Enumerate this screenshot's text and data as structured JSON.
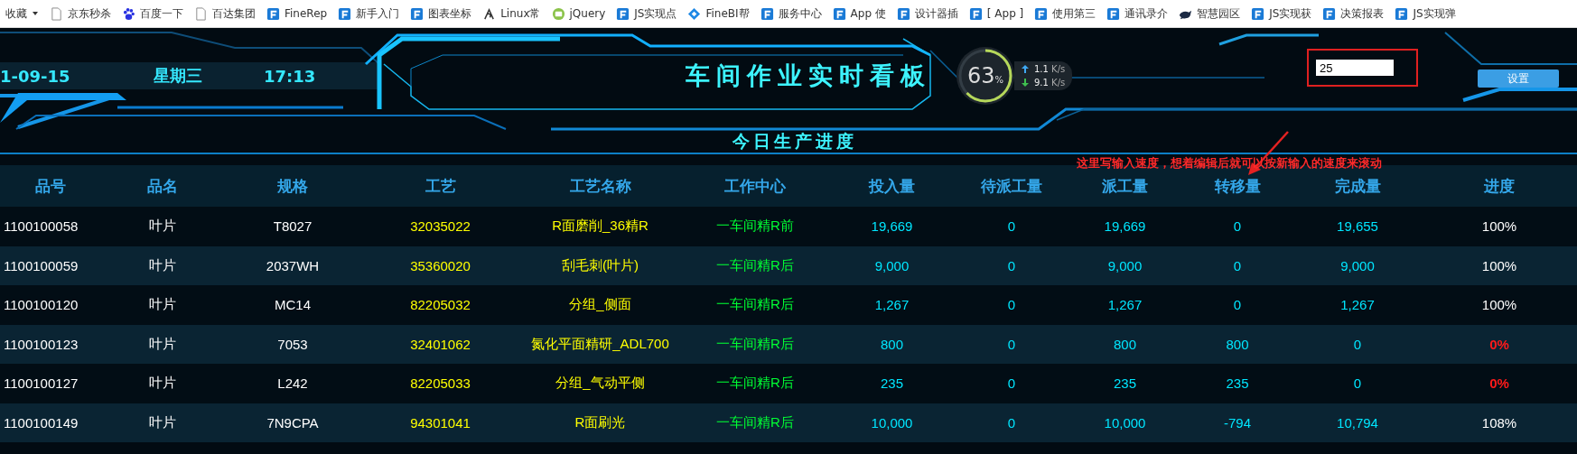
{
  "bookmarks": [
    {
      "kind": "menu",
      "label": "收藏"
    },
    {
      "kind": "page",
      "label": "京东秒杀"
    },
    {
      "kind": "paw",
      "label": "百度一下"
    },
    {
      "kind": "page",
      "label": "百达集团"
    },
    {
      "kind": "fr",
      "label": "FineRep"
    },
    {
      "kind": "fr",
      "label": "新手入门"
    },
    {
      "kind": "fr",
      "label": "图表坐标"
    },
    {
      "kind": "linux",
      "label": "Linux常"
    },
    {
      "kind": "jquery",
      "label": "jQuery"
    },
    {
      "kind": "fr",
      "label": "JS实现点"
    },
    {
      "kind": "finebi",
      "label": "FineBI帮"
    },
    {
      "kind": "fr",
      "label": "服务中心"
    },
    {
      "kind": "fr",
      "label": "App 使"
    },
    {
      "kind": "fr",
      "label": "设计器插"
    },
    {
      "kind": "fr",
      "label": "[ App ]"
    },
    {
      "kind": "fr",
      "label": "使用第三"
    },
    {
      "kind": "fr",
      "label": "通讯录介"
    },
    {
      "kind": "bird",
      "label": "智慧园区"
    },
    {
      "kind": "fr",
      "label": "JS实现获"
    },
    {
      "kind": "fr",
      "label": "决策报表"
    },
    {
      "kind": "fr",
      "label": "JS实现弹"
    }
  ],
  "header": {
    "date": "1-09-15",
    "weekday": "星期三",
    "time": "17:13",
    "title": "车间作业实时看板",
    "gauge": {
      "value": "63",
      "unit": "%",
      "level": 0.63,
      "up": "1.1",
      "up_unit": "K/s",
      "down": "9.1",
      "down_unit": "K/s"
    },
    "speed_input": {
      "value": "25"
    },
    "set_button": "设置"
  },
  "section_title": "今日生产进度",
  "annotation": "这里写输入速度，想着编辑后就可以按新输入的速度来滚动",
  "table": {
    "columns": [
      "品号",
      "品名",
      "规格",
      "工艺",
      "工艺名称",
      "工作中心",
      "投入量",
      "待派工量",
      "派工量",
      "转移量",
      "完成量",
      "进度"
    ],
    "rows": [
      {
        "cells": [
          "1100100058",
          "叶片",
          "T8027",
          "32035022",
          "R面磨削_36精R",
          "一车间精R前",
          "19,669",
          "0",
          "19,669",
          "0",
          "19,655",
          "100%"
        ],
        "alert": false
      },
      {
        "cells": [
          "1100100059",
          "叶片",
          "2037WH",
          "35360020",
          "刮毛刺(叶片)",
          "一车间精R后",
          "9,000",
          "0",
          "9,000",
          "0",
          "9,000",
          "100%"
        ],
        "alert": false
      },
      {
        "cells": [
          "1100100120",
          "叶片",
          "MC14",
          "82205032",
          "分组_侧面",
          "一车间精R后",
          "1,267",
          "0",
          "1,267",
          "0",
          "1,267",
          "100%"
        ],
        "alert": false
      },
      {
        "cells": [
          "1100100123",
          "叶片",
          "7053",
          "32401062",
          "氮化平面精研_ADL700",
          "一车间精R后",
          "800",
          "0",
          "800",
          "800",
          "0",
          "0%"
        ],
        "alert": true
      },
      {
        "cells": [
          "1100100127",
          "叶片",
          "L242",
          "82205033",
          "分组_气动平侧",
          "一车间精R后",
          "235",
          "0",
          "235",
          "235",
          "0",
          "0%"
        ],
        "alert": true
      },
      {
        "cells": [
          "1100100149",
          "叶片",
          "7N9CPA",
          "94301041",
          "R面刷光",
          "一车间精R后",
          "10,000",
          "0",
          "10,000",
          "-794",
          "10,794",
          "108%"
        ],
        "alert": false
      }
    ]
  }
}
